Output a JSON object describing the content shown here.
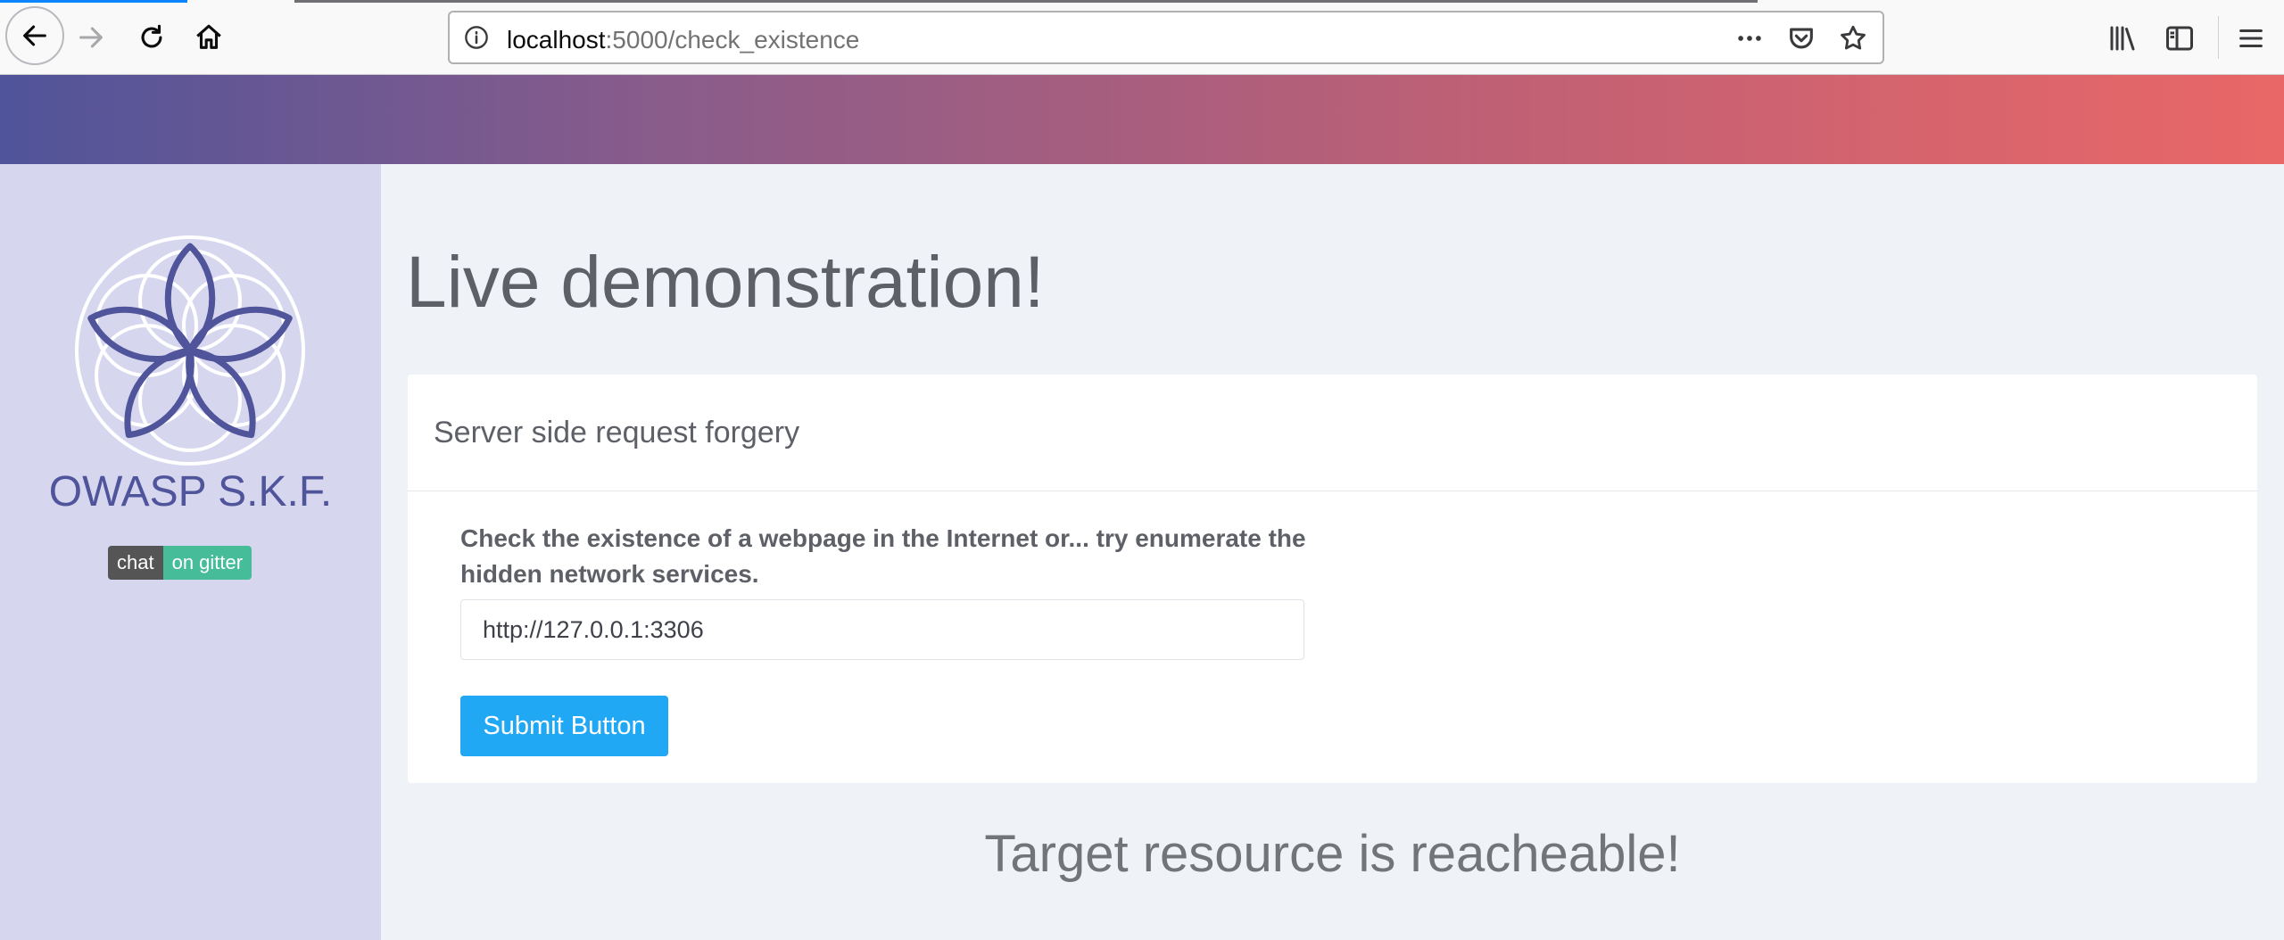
{
  "browser": {
    "url_host": "localhost",
    "url_rest": ":5000/check_existence"
  },
  "sidebar": {
    "brand": "OWASP S.K.F.",
    "badge_left": "chat",
    "badge_right": "on gitter"
  },
  "main": {
    "title": "Live demonstration!",
    "card_title": "Server side request forgery",
    "form_label": "Check the existence of a webpage in the Internet or... try enumerate the hidden network services.",
    "input_value": "http://127.0.0.1:3306",
    "submit_label": "Submit Button",
    "result": "Target resource is reacheable!"
  },
  "colors": {
    "accent": "#20a8f4",
    "brand": "#50549a",
    "sidebar_bg": "#d6d7ef"
  }
}
